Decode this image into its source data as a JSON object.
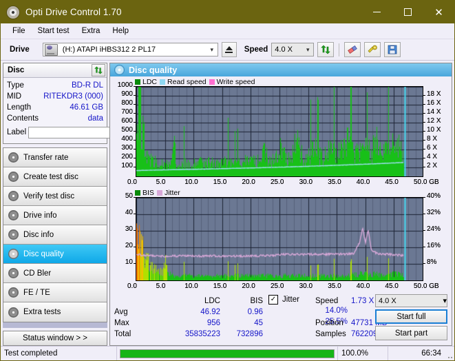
{
  "window": {
    "title": "Opti Drive Control 1.70",
    "icon": "disc-icon",
    "minimize": "−",
    "maximize": "□",
    "close": "✕"
  },
  "menu": {
    "items": [
      "File",
      "Start test",
      "Extra",
      "Help"
    ]
  },
  "toolbar": {
    "drive_label": "Drive",
    "drive_value": "(H:)   ATAPI iHBS312  2 PL17",
    "eject_icon": "eject-icon",
    "speed_label": "Speed",
    "speed_value": "4.0 X",
    "refresh_icon": "refresh-icon",
    "erase_icon": "eraser-icon",
    "tools_icon": "tools-icon",
    "save_icon": "save-icon"
  },
  "disc": {
    "group_title": "Disc",
    "refresh_icon": "refresh-icon",
    "rows": [
      {
        "key": "Type",
        "value": "BD-R DL"
      },
      {
        "key": "MID",
        "value": "RITEKDR3 (000)"
      },
      {
        "key": "Length",
        "value": "46.61 GB"
      },
      {
        "key": "Contents",
        "value": "data"
      }
    ],
    "label_key": "Label",
    "label_value": "",
    "label_placeholder": "",
    "disc_button_icon": "disc-icon"
  },
  "nav": {
    "items": [
      {
        "label": "Transfer rate",
        "icon": "disc-transfer-icon",
        "selected": false
      },
      {
        "label": "Create test disc",
        "icon": "disc-create-icon",
        "selected": false
      },
      {
        "label": "Verify test disc",
        "icon": "disc-verify-icon",
        "selected": false
      },
      {
        "label": "Drive info",
        "icon": "drive-info-icon",
        "selected": false
      },
      {
        "label": "Disc info",
        "icon": "disc-info-icon",
        "selected": false
      },
      {
        "label": "Disc quality",
        "icon": "disc-quality-icon",
        "selected": true
      },
      {
        "label": "CD Bler",
        "icon": "cd-bler-icon",
        "selected": false
      },
      {
        "label": "FE / TE",
        "icon": "fe-te-icon",
        "selected": false
      },
      {
        "label": "Extra tests",
        "icon": "extra-tests-icon",
        "selected": false
      }
    ],
    "status_window": "Status window > >"
  },
  "panel": {
    "title": "Disc quality",
    "icon": "disc-quality-icon"
  },
  "stats": {
    "col_ldc": "LDC",
    "col_bis": "BIS",
    "jitter_label": "Jitter",
    "jitter_checked": true,
    "rows": [
      {
        "label": "Avg",
        "ldc": "46.92",
        "bis": "0.96",
        "jitter": "14.0%"
      },
      {
        "label": "Max",
        "ldc": "956",
        "bis": "45",
        "jitter": "25.5%"
      },
      {
        "label": "Total",
        "ldc": "35835223",
        "bis": "732896",
        "jitter": ""
      }
    ],
    "speed_label": "Speed",
    "speed_value": "1.73 X",
    "position_label": "Position",
    "position_value": "47731 MB",
    "samples_label": "Samples",
    "samples_value": "762209",
    "speed_select": "4.0 X",
    "start_full": "Start full",
    "start_part": "Start part"
  },
  "statusbar": {
    "message": "Test completed",
    "percent_text": "100.0%",
    "percent_value": 100,
    "elapsed": "66:34"
  },
  "colors": {
    "title_bar": "#6b6410",
    "accent": "#49a6dc",
    "ldc_green": "#18c018",
    "read_speed": "#9fdff5",
    "write_speed": "#ff6fd0",
    "jitter_pink": "#d8a8d8",
    "plot_bg": "#6b7893",
    "value_blue": "#1414c8",
    "progress_green": "#16b516",
    "marker_cyan": "#46d8f0"
  },
  "chart_data": [
    {
      "type": "line",
      "id": "ldc-chart",
      "title": "",
      "xlabel": "GB",
      "ylabel": "",
      "xlim": [
        0,
        50
      ],
      "ylim": [
        0,
        1000
      ],
      "y2lim": [
        0,
        20
      ],
      "y2label": "X",
      "grid": true,
      "legend_position": "top-left",
      "xticks": [
        "0.0",
        "5.0",
        "10.0",
        "15.0",
        "20.0",
        "25.0",
        "30.0",
        "35.0",
        "40.0",
        "45.0",
        "50.0 GB"
      ],
      "yticks": [
        100,
        200,
        300,
        400,
        500,
        600,
        700,
        800,
        900,
        1000
      ],
      "y2ticks": [
        "2 X",
        "4 X",
        "6 X",
        "8 X",
        "10 X",
        "12 X",
        "14 X",
        "16 X",
        "18 X"
      ],
      "legend": [
        {
          "name": "LDC",
          "color": "#18c018"
        },
        {
          "name": "Read speed",
          "color": "#9fdff5"
        },
        {
          "name": "Write speed",
          "color": "#ff6fd0"
        }
      ],
      "series": [
        {
          "name": "LDC",
          "type": "bar",
          "color": "#18c018",
          "x": [
            0.2,
            0.4,
            0.6,
            0.8,
            1.0,
            1.2,
            1.4,
            1.6,
            1.8,
            2.0,
            2.4,
            2.8,
            3.2,
            3.6,
            4.0,
            4.6,
            5.2,
            5.8,
            6.4,
            7.0,
            7.6,
            8.2,
            8.8,
            9.4,
            10.0,
            11.0,
            12.0,
            13.0,
            14.0,
            15.0,
            16.0,
            17.0,
            18.0,
            19.0,
            20.0,
            21.0,
            22.0,
            23.0,
            24.0,
            25.0,
            26.0,
            27.0,
            28.0,
            29.0,
            30.0,
            31.0,
            32.0,
            33.0,
            34.0,
            35.0,
            36.0,
            37.0,
            38.0,
            39.0,
            40.0,
            41.0,
            42.0,
            43.0,
            44.0,
            45.0,
            46.0,
            46.6
          ],
          "values": [
            420,
            960,
            780,
            700,
            560,
            500,
            420,
            300,
            260,
            220,
            200,
            185,
            170,
            160,
            150,
            150,
            145,
            140,
            520,
            140,
            140,
            150,
            145,
            140,
            150,
            160,
            150,
            160,
            150,
            160,
            170,
            165,
            150,
            180,
            170,
            175,
            330,
            190,
            180,
            420,
            200,
            200,
            430,
            220,
            230,
            360,
            230,
            240,
            350,
            260,
            310,
            420,
            270,
            280,
            320,
            290,
            420,
            300,
            310,
            520,
            320,
            200
          ]
        },
        {
          "name": "Read speed",
          "type": "line",
          "color": "#9fdff5",
          "axis": "y2",
          "x": [
            0.0,
            5.0,
            10.0,
            15.0,
            20.0,
            25.0,
            30.0,
            35.0,
            40.0,
            45.0,
            46.6
          ],
          "values": [
            1.3,
            1.45,
            1.58,
            1.72,
            1.88,
            2.05,
            2.25,
            2.48,
            2.72,
            3.0,
            3.1
          ]
        },
        {
          "name": "Write speed",
          "type": "line",
          "color": "#ff6fd0",
          "x": [],
          "values": []
        }
      ],
      "annotations": [
        {
          "type": "vline",
          "x": 46.9,
          "color": "#46d8f0"
        }
      ]
    },
    {
      "type": "bar",
      "id": "bis-jitter-chart",
      "title": "",
      "xlabel": "GB",
      "ylabel": "",
      "xlim": [
        0,
        50
      ],
      "ylim": [
        0,
        50
      ],
      "y2lim": [
        0,
        40
      ],
      "y2label": "%",
      "grid": true,
      "legend_position": "top-left",
      "xticks": [
        "0.0",
        "5.0",
        "10.0",
        "15.0",
        "20.0",
        "25.0",
        "30.0",
        "35.0",
        "40.0",
        "45.0",
        "50.0 GB"
      ],
      "yticks": [
        10,
        20,
        30,
        40,
        50
      ],
      "y2ticks": [
        "8%",
        "16%",
        "24%",
        "32%",
        "40%"
      ],
      "legend": [
        {
          "name": "BIS",
          "color": "#18c018"
        },
        {
          "name": "Jitter",
          "color": "#d8a8d8"
        }
      ],
      "series": [
        {
          "name": "BIS",
          "type": "bar",
          "color_scale": [
            "#18c018",
            "#b0e000",
            "#f0c000",
            "#f07000",
            "#e01818"
          ],
          "x": [
            0.1,
            0.2,
            0.3,
            0.4,
            0.5,
            0.6,
            0.7,
            0.8,
            0.9,
            1.0,
            1.2,
            1.4,
            1.6,
            1.8,
            2.0,
            2.2,
            2.4,
            2.6,
            2.8,
            3.0,
            3.4,
            3.8,
            4.2,
            4.6,
            5.0,
            5.6,
            6.2,
            6.8,
            7.4,
            8.0,
            9.0,
            10.0,
            11.0,
            12.0,
            13.0,
            14.0,
            15.0,
            16.0,
            17.0,
            18.0,
            19.0,
            20.0,
            21.0,
            22.0,
            23.0,
            24.0,
            25.0,
            26.0,
            27.0,
            28.0,
            29.0,
            30.0,
            31.0,
            32.0,
            33.0,
            34.0,
            35.0,
            36.0,
            37.0,
            38.0,
            39.0,
            40.0,
            41.0,
            42.0,
            43.0,
            44.0,
            45.0,
            46.0,
            46.6
          ],
          "values": [
            30,
            45,
            38,
            42,
            40,
            33,
            28,
            25,
            22,
            20,
            18,
            16,
            14,
            13,
            12,
            11,
            10,
            9,
            9,
            8,
            7,
            6,
            6,
            5,
            12,
            4,
            4,
            3,
            3,
            3,
            3,
            3,
            3,
            3,
            3,
            3,
            3,
            3,
            3,
            3,
            3,
            3,
            3,
            3,
            3,
            3,
            3,
            3,
            3,
            3,
            3,
            3,
            3,
            3,
            3,
            3,
            3,
            3,
            3,
            4,
            4,
            5,
            4,
            4,
            4,
            4,
            4,
            4,
            3
          ]
        },
        {
          "name": "Jitter",
          "type": "line",
          "color": "#d8a8d8",
          "axis": "y2",
          "x": [
            0.0,
            1.0,
            2.0,
            3.0,
            4.0,
            5.0,
            8.0,
            12.0,
            16.0,
            20.0,
            24.0,
            25.0,
            28.0,
            32.0,
            36.0,
            38.0,
            39.0,
            39.5,
            40.0,
            40.5,
            41.0,
            42.0,
            44.0,
            45.0,
            46.0,
            46.6
          ],
          "values": [
            12.6,
            12.2,
            12.0,
            11.8,
            11.8,
            11.8,
            11.8,
            11.8,
            11.8,
            11.9,
            12.0,
            12.6,
            12.6,
            12.6,
            12.7,
            13.0,
            18.5,
            25.5,
            18.0,
            24.5,
            15.0,
            13.0,
            12.6,
            12.4,
            12.2,
            12.0
          ]
        }
      ],
      "annotations": [
        {
          "type": "vline",
          "x": 46.9,
          "color": "#46d8f0"
        }
      ]
    }
  ]
}
